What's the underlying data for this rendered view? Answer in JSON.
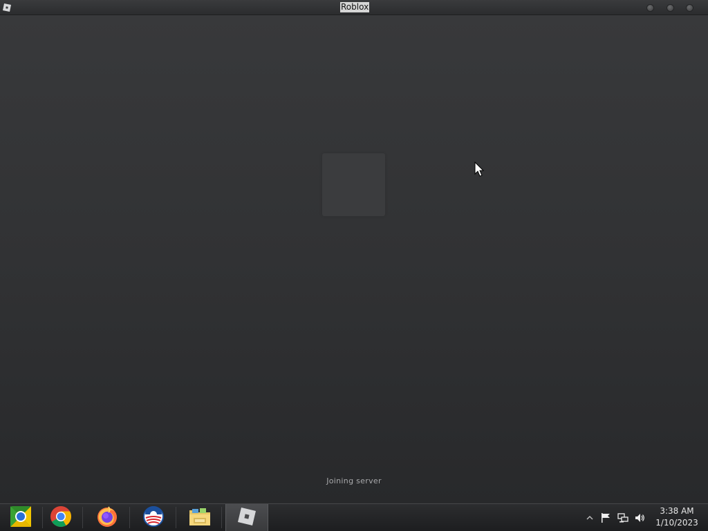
{
  "window": {
    "title": "Roblox",
    "app_icon": "roblox-logo-icon",
    "controls": [
      "minimize-icon",
      "maximize-icon",
      "close-icon"
    ]
  },
  "content": {
    "status_text": "Joining server",
    "loading_placeholder": "loading-square"
  },
  "taskbar": {
    "apps": [
      {
        "name": "chrome-canary",
        "icon": "chrome-canary-icon"
      },
      {
        "name": "chrome",
        "icon": "chrome-icon"
      },
      {
        "name": "firefox",
        "icon": "firefox-icon"
      },
      {
        "name": "obama-logo",
        "icon": "obama-logo-icon"
      },
      {
        "name": "file-explorer",
        "icon": "folder-icon"
      },
      {
        "name": "roblox",
        "icon": "roblox-icon",
        "active": true
      }
    ],
    "tray": {
      "icons": [
        "show-hidden-icon",
        "flag-icon",
        "network-icon",
        "volume-icon"
      ],
      "time": "3:38 AM",
      "date": "1/10/2023"
    }
  },
  "colors": {
    "background": "#2f3032",
    "taskbar": "#1d1e20",
    "status_text": "#a9aaac"
  }
}
